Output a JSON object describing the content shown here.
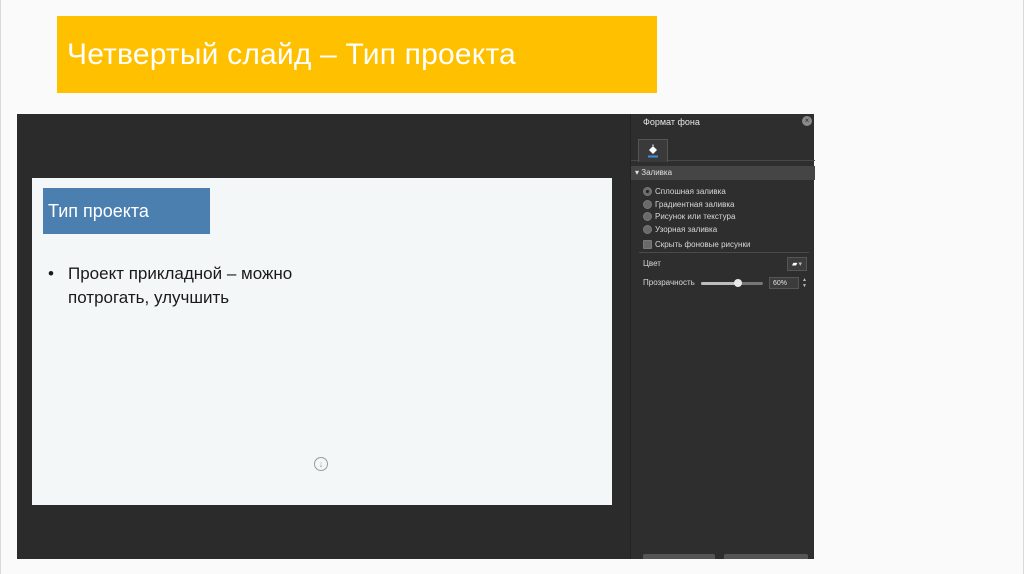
{
  "banner": {
    "title": "Четвертый слайд – Тип проекта"
  },
  "slide": {
    "title": "Тип проекта",
    "bullet_text": "Проект прикладной – можно потрогать, улучшить",
    "bullet_symbol": "•"
  },
  "panel": {
    "title": "Формат фона",
    "section_label": "Заливка",
    "fill_options": [
      {
        "label": "Сплошная заливка",
        "selected": true
      },
      {
        "label": "Градиентная заливка",
        "selected": false
      },
      {
        "label": "Рисунок или текстура",
        "selected": false
      },
      {
        "label": "Узорная заливка",
        "selected": false
      }
    ],
    "hide_background_label": "Скрыть фоновые рисунки",
    "color_label": "Цвет",
    "transparency_label": "Прозрачность",
    "transparency_value": "60%",
    "transparency_fraction": 0.6
  },
  "colors": {
    "banner": "#ffc000",
    "slide_title_bg": "#4a7fb0",
    "app_background": "#2b2b2b"
  }
}
